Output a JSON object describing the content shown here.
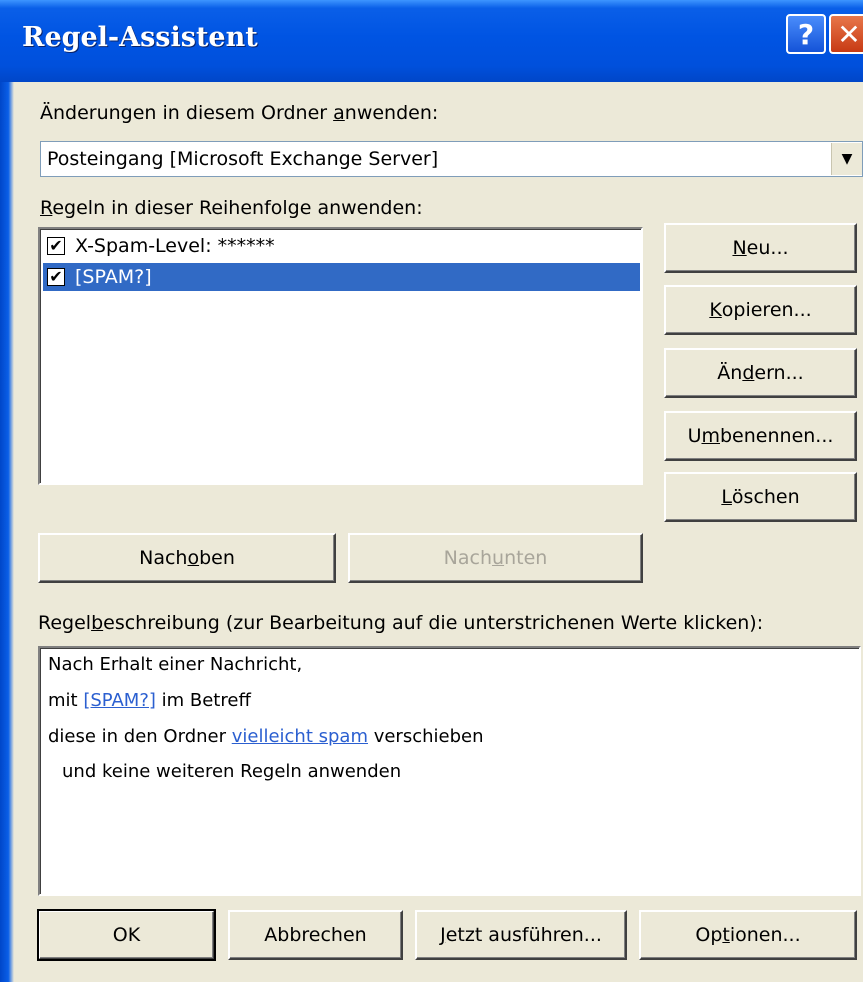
{
  "window": {
    "title": "Regel-Assistent",
    "help_glyph": "?",
    "close_glyph": "✕"
  },
  "folder": {
    "label_pre": "Änderungen in diesem Ordner ",
    "label_ul": "a",
    "label_post": "nwenden:",
    "value": "Posteingang [Microsoft Exchange Server]",
    "arrow": "▼"
  },
  "rules": {
    "label_ul": "R",
    "label_post": "egeln in dieser Reihenfolge anwenden:",
    "items": [
      {
        "label": "X-Spam-Level: ******",
        "checked": true,
        "selected": false
      },
      {
        "label": "[SPAM?]",
        "checked": true,
        "selected": true
      }
    ],
    "check_glyph": "✔"
  },
  "side_buttons": {
    "new": {
      "ul": "N",
      "rest": "eu..."
    },
    "copy": {
      "ul": "K",
      "rest": "opieren..."
    },
    "change": {
      "pre": "Än",
      "ul": "d",
      "rest": "ern..."
    },
    "rename": {
      "pre": "U",
      "ul": "m",
      "rest": "benennen..."
    },
    "delete": {
      "ul": "L",
      "rest": "öschen"
    }
  },
  "move_buttons": {
    "up": {
      "pre": "Nach ",
      "ul": "o",
      "rest": "ben"
    },
    "down": {
      "pre": "Nach ",
      "ul": "u",
      "rest": "nten"
    }
  },
  "description": {
    "label_pre": "Regel",
    "label_ul": "b",
    "label_post": "eschreibung (zur Bearbeitung auf die unterstrichenen Werte klicken):",
    "line1": "Nach Erhalt einer Nachricht,",
    "line2_pre": "mit ",
    "line2_link": "[SPAM?]",
    "line2_post": " im Betreff",
    "line3_pre": "diese in den Ordner ",
    "line3_link": "vielleicht spam",
    "line3_post": " verschieben",
    "line4": "und keine weiteren Regeln anwenden"
  },
  "footer": {
    "ok": "OK",
    "cancel": "Abbrechen",
    "run_ul": "J",
    "run_rest": "etzt ausführen...",
    "options_pre": "Op",
    "options_ul": "t",
    "options_rest": "ionen..."
  }
}
